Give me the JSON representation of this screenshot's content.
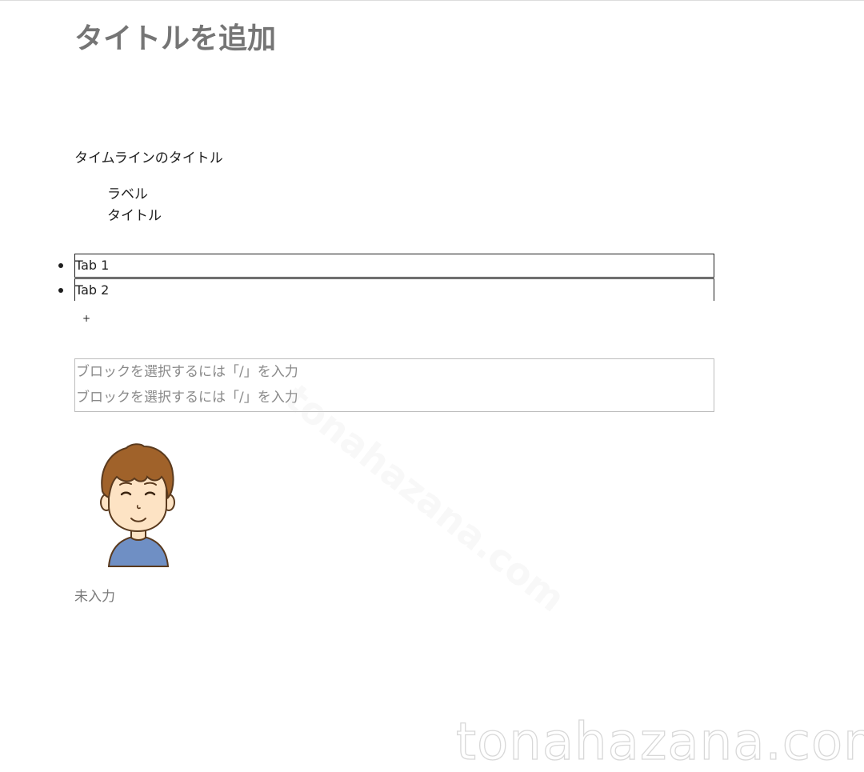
{
  "page": {
    "title": "タイトルを追加"
  },
  "timeline": {
    "title": "タイムラインのタイトル",
    "label": "ラベル",
    "item_title": "タイトル"
  },
  "tabs": {
    "items": [
      {
        "label": "Tab 1"
      },
      {
        "label": "Tab 2"
      }
    ],
    "add_label": "+"
  },
  "block_editor": {
    "placeholders": [
      "ブロックを選択するには「/」を入力",
      "ブロックを選択するには「/」を入力"
    ]
  },
  "avatar": {
    "icon": "boy-avatar-icon"
  },
  "unfilled_label": "未入力",
  "watermark": {
    "corner_text": "tonahazana.com",
    "diagonal_text": "tonahazana.com"
  },
  "colors": {
    "title_gray": "#757575",
    "text": "#1e1e1e",
    "placeholder": "#8a8a8a",
    "shirt_blue": "#6f8fc4",
    "hair_brown": "#a0622a"
  }
}
